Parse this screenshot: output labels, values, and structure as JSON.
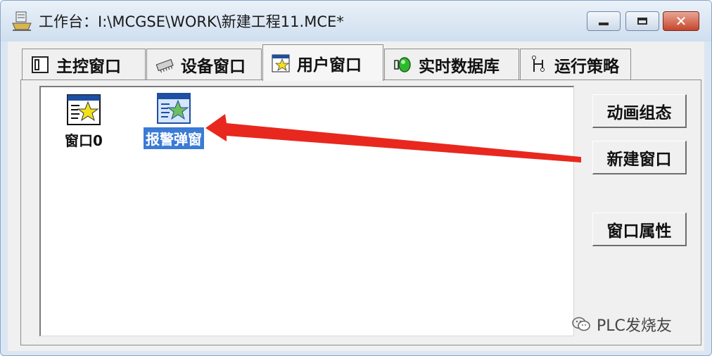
{
  "window": {
    "title": "工作台：I:\\MCGSE\\WORK\\新建工程11.MCE*",
    "controls": {
      "minimize": "minimize",
      "maximize": "maximize",
      "close": "✕"
    }
  },
  "tabs": [
    {
      "label": "主控窗口",
      "icon": "main-control-icon",
      "active": false
    },
    {
      "label": "设备窗口",
      "icon": "device-icon",
      "active": false
    },
    {
      "label": "用户窗口",
      "icon": "user-window-icon",
      "active": true
    },
    {
      "label": "实时数据库",
      "icon": "realtime-db-icon",
      "active": false
    },
    {
      "label": "运行策略",
      "icon": "strategy-icon",
      "active": false
    }
  ],
  "windows_list": [
    {
      "label": "窗口0",
      "icon": "window-star-icon",
      "selected": false
    },
    {
      "label": "报警弹窗",
      "icon": "window-star-icon",
      "selected": true
    }
  ],
  "side_buttons": {
    "animation": "动画组态",
    "new_window": "新建窗口",
    "window_props": "窗口属性"
  },
  "annotation": {
    "type": "red-arrow",
    "from": "new-window-button",
    "to": "selected-window-item",
    "color": "#e8281e"
  },
  "watermark": "PLC发烧友",
  "colors": {
    "selection": "#3a7bd5",
    "close_button": "#c6452c",
    "arrow": "#e8281e"
  }
}
